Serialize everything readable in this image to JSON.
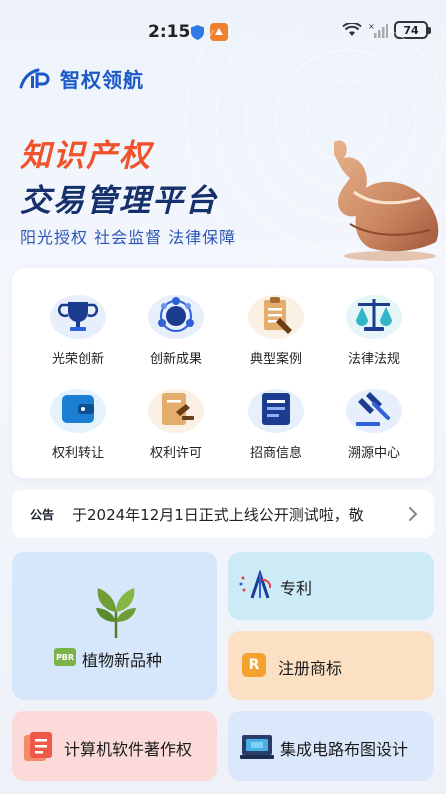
{
  "status": {
    "time": "2:15",
    "battery": "74"
  },
  "brand": {
    "name": "智权领航"
  },
  "hero": {
    "title_line1": "知识产权",
    "title_line2": "交易管理平台",
    "slogan": "阳光授权 社会监督 法律保障"
  },
  "grid": [
    {
      "label": "光荣创新",
      "icon": "trophy-icon"
    },
    {
      "label": "创新成果",
      "icon": "network-icon"
    },
    {
      "label": "典型案例",
      "icon": "clipboard-icon"
    },
    {
      "label": "法律法规",
      "icon": "scales-icon"
    },
    {
      "label": "权利转让",
      "icon": "wallet-icon"
    },
    {
      "label": "权利许可",
      "icon": "gavel-doc-icon"
    },
    {
      "label": "招商信息",
      "icon": "document-icon"
    },
    {
      "label": "溯源中心",
      "icon": "judge-hammer-icon"
    }
  ],
  "notice": {
    "tag": "公告",
    "text": "于2024年12月1日正式上线公开测试啦，敬"
  },
  "tiles": {
    "plants": {
      "label": "植物新品种",
      "badge": "PBR"
    },
    "patent": {
      "label": "专利"
    },
    "trademark": {
      "label": "注册商标",
      "badge": "R"
    },
    "software": {
      "label": "计算机软件著作权"
    },
    "ic": {
      "label": "集成电路布图设计"
    }
  },
  "colors": {
    "brand_blue": "#1b58c8",
    "title_orange": "#f0522b",
    "title_navy": "#16306b"
  }
}
